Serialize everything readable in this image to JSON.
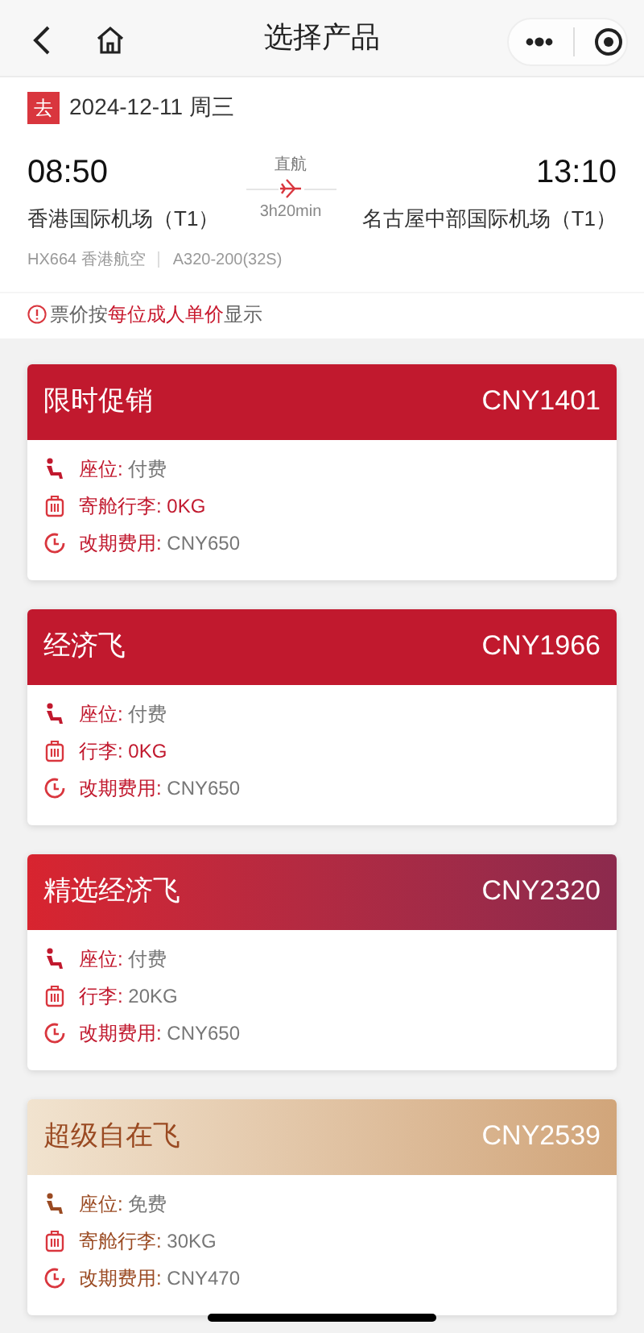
{
  "nav": {
    "title": "选择产品"
  },
  "flight": {
    "tag": "去",
    "date": "2024-12-11 周三",
    "depart_time": "08:50",
    "depart_airport": "香港国际机场（T1）",
    "stop_type": "直航",
    "duration": "3h20min",
    "arrive_time": "13:10",
    "arrive_airport": "名古屋中部国际机场（T1）",
    "flight_no": "HX664 香港航空",
    "aircraft": "A320-200(32S)"
  },
  "notice": "票价按**每位成人单价**显示",
  "products": [
    {
      "kind": "promo",
      "name": "限时促销",
      "price": "CNY1401",
      "features": [
        {
          "kind": "seat",
          "label": "座位:",
          "value": "付费",
          "highlight": false
        },
        {
          "kind": "baggage",
          "label": "寄舱行李:",
          "value": "0KG",
          "highlight": true
        },
        {
          "kind": "change",
          "label": "改期费用:",
          "value": "CNY650",
          "highlight": false
        }
      ]
    },
    {
      "kind": "promo",
      "name": "经济飞",
      "price": "CNY1966",
      "features": [
        {
          "kind": "seat",
          "label": "座位:",
          "value": "付费",
          "highlight": false
        },
        {
          "kind": "baggage",
          "label": "行李:",
          "value": "0KG",
          "highlight": true
        },
        {
          "kind": "change",
          "label": "改期费用:",
          "value": "CNY650",
          "highlight": false
        }
      ]
    },
    {
      "kind": "select",
      "name": "精选经济飞",
      "price": "CNY2320",
      "features": [
        {
          "kind": "seat",
          "label": "座位:",
          "value": "付费",
          "highlight": false
        },
        {
          "kind": "baggage",
          "label": "行李:",
          "value": "20KG",
          "highlight": false
        },
        {
          "kind": "change",
          "label": "改期费用:",
          "value": "CNY650",
          "highlight": false
        }
      ]
    },
    {
      "kind": "premium",
      "name": "超级自在飞",
      "price": "CNY2539",
      "features": [
        {
          "kind": "seat",
          "label": "座位:",
          "value": "免费",
          "highlight": false
        },
        {
          "kind": "baggage",
          "label": "寄舱行李:",
          "value": "30KG",
          "highlight": false
        },
        {
          "kind": "change",
          "label": "改期费用:",
          "value": "CNY470",
          "highlight": false
        }
      ]
    }
  ]
}
